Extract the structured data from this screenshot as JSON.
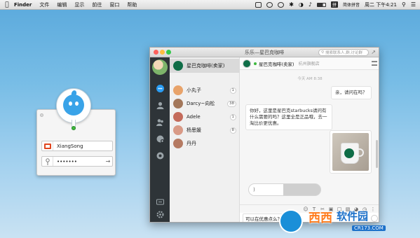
{
  "menubar": {
    "app": "Finder",
    "items": [
      "文件",
      "编辑",
      "显示",
      "前往",
      "窗口",
      "帮助"
    ],
    "ime": "简体拼音",
    "clock": "周二 下午4:21"
  },
  "login": {
    "username": "XiangSong",
    "password": "•••••••"
  },
  "window": {
    "title": "乐乐—星巴克咖啡",
    "search_placeholder": "搜索联系人,群,讨论群"
  },
  "contacts": [
    {
      "name": "星巴克咖啡(卖家)",
      "badge": "",
      "color": "#0f6d47",
      "selected": true
    },
    {
      "name": "小丸子",
      "badge": "1",
      "color": "#e8a36a",
      "selected": false
    },
    {
      "name": "Darcy~向松",
      "badge": "38",
      "color": "#a3775a",
      "selected": false
    },
    {
      "name": "Adele",
      "badge": "1",
      "color": "#c46b5b",
      "selected": false
    },
    {
      "name": "杨思媛",
      "badge": "8",
      "color": "#d99a86",
      "selected": false
    },
    {
      "name": "丹丹",
      "badge": "",
      "color": "#b57a62",
      "selected": false
    }
  ],
  "chat": {
    "header_name": "星巴克咖啡(卖家)",
    "header_sub": "杭州旗舰店",
    "timestamp": "今天 AM 8:38",
    "msg_out": "亲，请问在吗？",
    "msg_in": "你好，这里是星巴克starbucks请问有什么需要的吗？这里全是正品哦，去一淘比价更优惠。",
    "voice_icon": "voice-icon",
    "input_text": "可以在优惠点么？"
  },
  "watermark": {
    "brand_a": "西西",
    "brand_b": "软件园",
    "url": "CR173.COM"
  }
}
